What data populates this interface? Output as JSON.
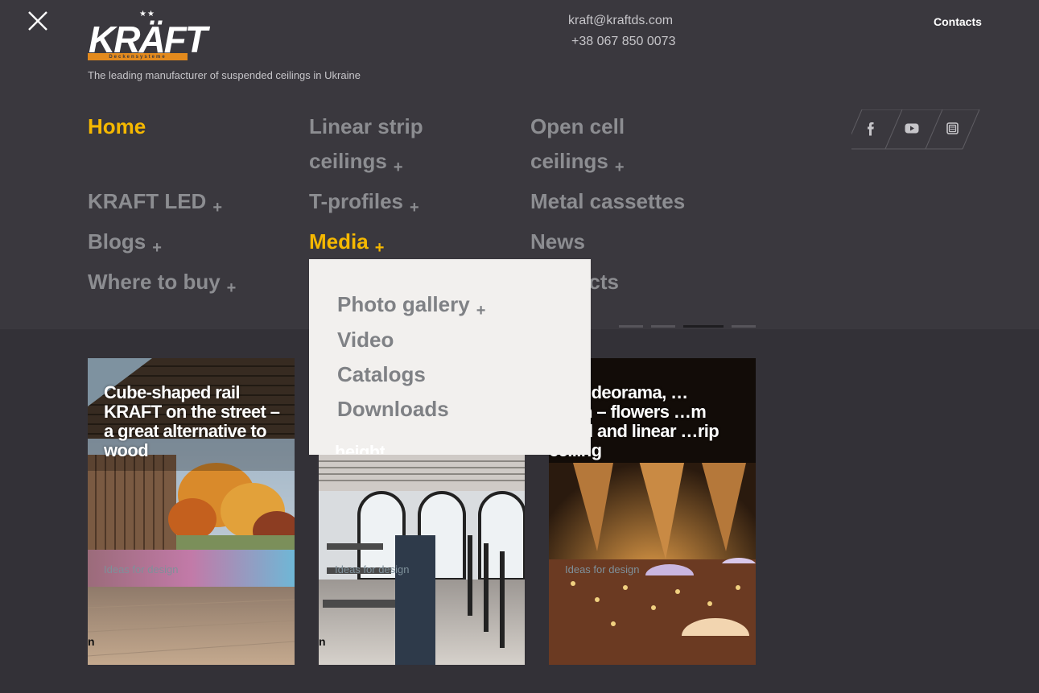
{
  "header": {
    "logo": {
      "word": "KRÄFT",
      "stars": "★★",
      "subline": "Deckensysteme"
    },
    "tagline": "The leading manufacturer of suspended ceilings in Ukraine",
    "email": "kraft@kraftds.com",
    "phone": "+38 067 850 0073",
    "contacts_link": "Contacts"
  },
  "icons": {
    "close": "close-icon",
    "social": [
      "facebook-icon",
      "youtube-icon",
      "instagram-icon"
    ]
  },
  "menu": {
    "plus_symbol": "+",
    "home": "Home",
    "linear_strip": {
      "line1": "Linear strip",
      "line2": "ceilings"
    },
    "open_cell": {
      "line1": "Open cell",
      "line2": "ceilings"
    },
    "kraft_led": "KRAFT LED",
    "t_profiles": "T-profiles",
    "metal_cassettes": "Metal cassettes",
    "blogs": "Blogs",
    "media": "Media",
    "news": "News",
    "where_to_buy": "Where to buy",
    "contacts_partial": "cts"
  },
  "media_dropdown": {
    "items": [
      "Photo gallery",
      "Video",
      "Catalogs",
      "Downloads"
    ]
  },
  "carousel": {
    "total_dots": 4,
    "active_dot": 3
  },
  "cards": [
    {
      "title": "Cube-shaped rail KRAFT on the street – a great alternative to wood",
      "tag": "Ideas for design",
      "edge_letter": "n"
    },
    {
      "title_visible": "height",
      "tag": "Ideas for design",
      "edge_letter": "n"
    },
    {
      "title": "…quideorama, …dellin – flowers …m metal and linear …rip ceiling",
      "tag": "Ideas for design"
    }
  ],
  "colors": {
    "background_top": "#3a383e",
    "background_bottom": "#333137",
    "accent": "#f5b800",
    "menu_text": "#8c8d91",
    "dropdown_bg": "#f2f0ee",
    "logo_orange": "#e38a1d"
  }
}
